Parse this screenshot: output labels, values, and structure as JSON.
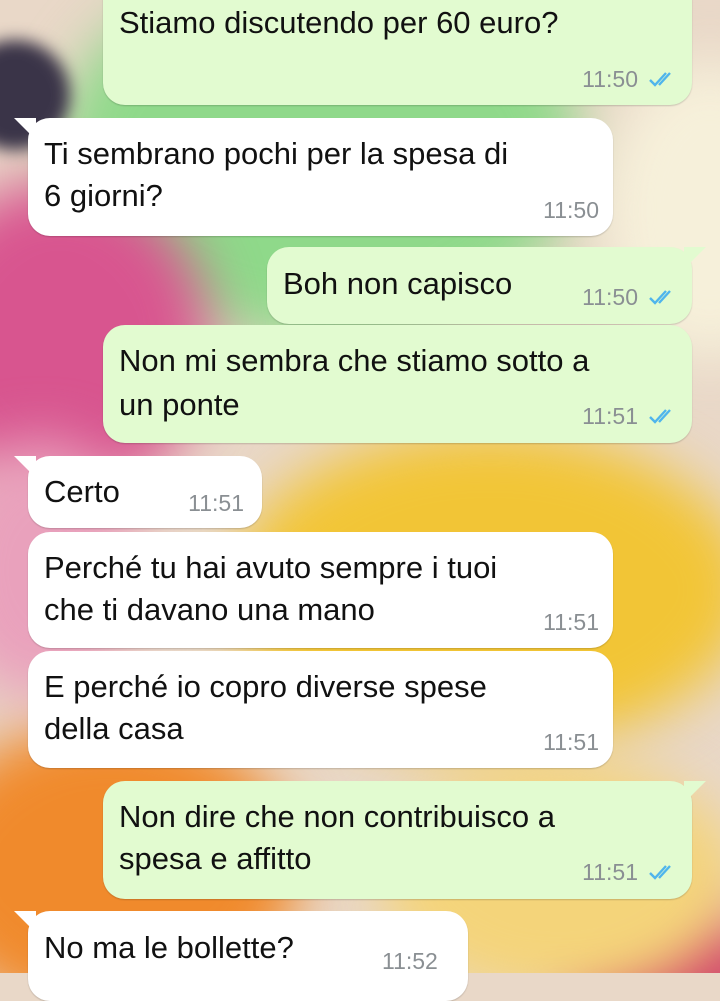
{
  "colors": {
    "incoming_bubble": "#ffffff",
    "outgoing_bubble": "#e2fbd0",
    "read_ticks": "#4fb5ec",
    "timestamp": "#8a8f93"
  },
  "messages": [
    {
      "direction": "outgoing",
      "lines": [
        "Stiamo discutendo per 60 euro?"
      ],
      "time": "11:50",
      "status_icon": "double-check-read-icon"
    },
    {
      "direction": "incoming",
      "lines": [
        "Ti sembrano pochi per la spesa di",
        "6 giorni?"
      ],
      "time": "11:50"
    },
    {
      "direction": "outgoing",
      "lines": [
        "Boh non capisco"
      ],
      "time": "11:50",
      "status_icon": "double-check-read-icon"
    },
    {
      "direction": "outgoing",
      "lines": [
        "Non mi sembra che stiamo sotto a",
        "un ponte"
      ],
      "time": "11:51",
      "status_icon": "double-check-read-icon"
    },
    {
      "direction": "incoming",
      "lines": [
        "Certo"
      ],
      "time": "11:51"
    },
    {
      "direction": "incoming",
      "lines": [
        "Perché tu hai avuto sempre i tuoi",
        "che ti davano una mano"
      ],
      "time": "11:51"
    },
    {
      "direction": "incoming",
      "lines": [
        "E perché io copro diverse spese",
        "della casa"
      ],
      "time": "11:51"
    },
    {
      "direction": "outgoing",
      "lines": [
        "Non dire che non contribuisco a",
        "spesa e affitto"
      ],
      "time": "11:51",
      "status_icon": "double-check-read-icon"
    },
    {
      "direction": "incoming",
      "lines": [
        "No ma le bollette?"
      ],
      "time": "11:52"
    }
  ]
}
